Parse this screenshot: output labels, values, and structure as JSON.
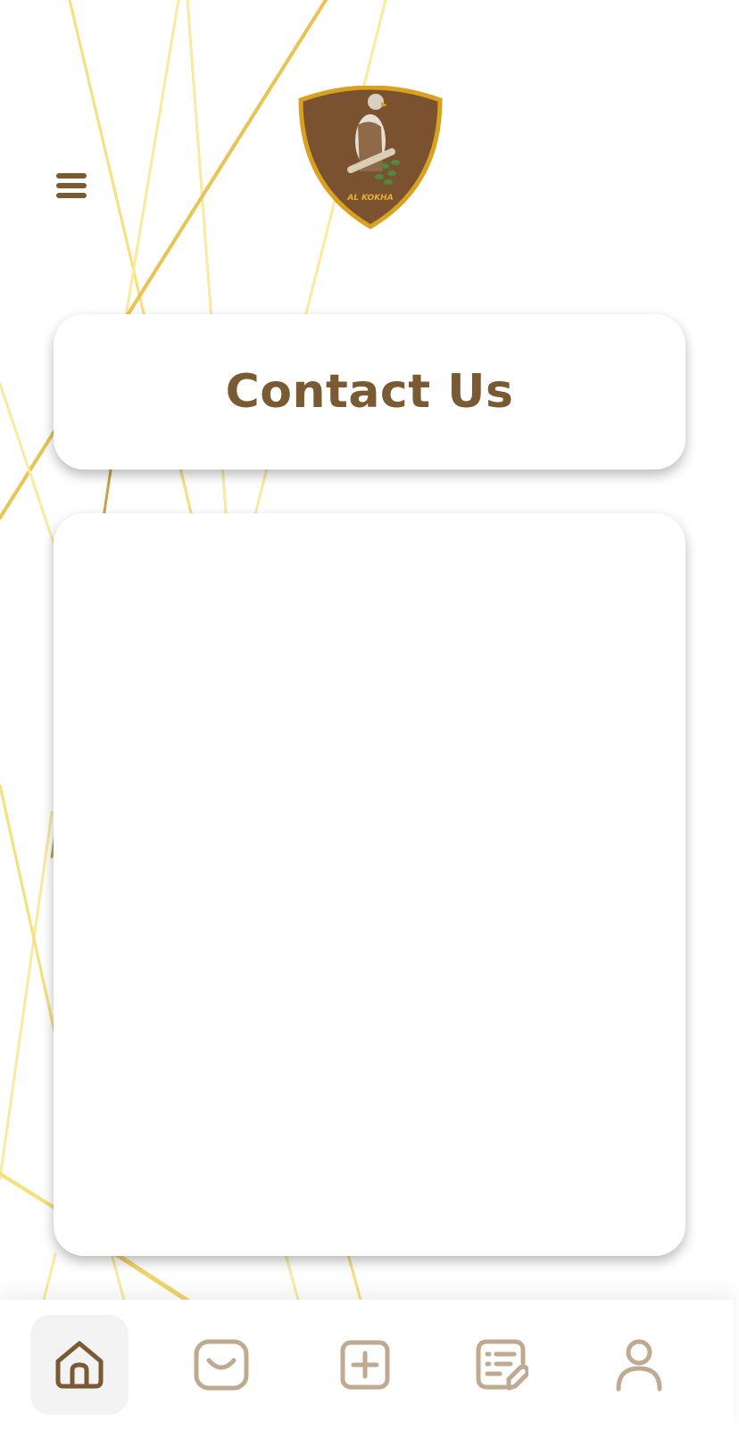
{
  "header": {
    "menu_icon": "hamburger-menu-icon",
    "logo_text": "AL KOKHA"
  },
  "title_card": {
    "title": "Contact Us"
  },
  "bottom_nav": {
    "items": [
      {
        "icon": "home-icon",
        "active": true
      },
      {
        "icon": "inbox-icon",
        "active": false
      },
      {
        "icon": "add-icon",
        "active": false
      },
      {
        "icon": "edit-list-icon",
        "active": false
      },
      {
        "icon": "profile-icon",
        "active": false
      }
    ]
  },
  "colors": {
    "brand_brown": "#7a5a33",
    "gold": "#d4a22a",
    "nav_icon_inactive": "#bfa98f",
    "line_yellow": "#f7e08a"
  }
}
